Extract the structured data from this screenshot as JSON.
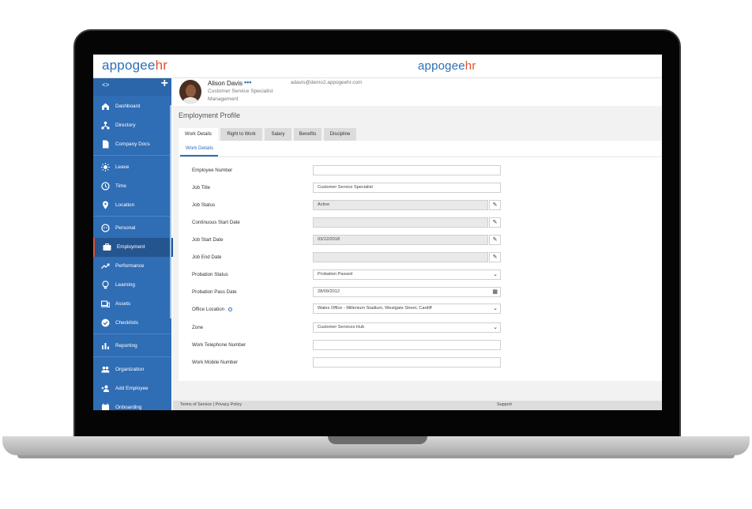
{
  "app": {
    "brand_left": {
      "part1": "appogee",
      "part2": "hr"
    },
    "brand_center": {
      "part1": "appogee",
      "part2": "hr"
    },
    "colors": {
      "brand_blue": "#2d6fb6",
      "brand_orange": "#e0532f",
      "sidebar": "#2f6db5"
    }
  },
  "sidebar": {
    "toggle_glyph": "<>",
    "add_glyph": "+",
    "items": [
      {
        "label": "Dashboard",
        "icon": "home-icon"
      },
      {
        "label": "Directory",
        "icon": "org-tree-icon"
      },
      {
        "label": "Company Docs",
        "icon": "document-icon"
      },
      {
        "label": "Leave",
        "icon": "sun-icon"
      },
      {
        "label": "Time",
        "icon": "clock-icon"
      },
      {
        "label": "Location",
        "icon": "map-pin-icon"
      },
      {
        "label": "Personal",
        "icon": "face-icon"
      },
      {
        "label": "Employment",
        "icon": "briefcase-icon",
        "active": true
      },
      {
        "label": "Performance",
        "icon": "trend-icon"
      },
      {
        "label": "Learning",
        "icon": "lightbulb-icon"
      },
      {
        "label": "Assets",
        "icon": "devices-icon"
      },
      {
        "label": "Checklists",
        "icon": "check-circle-icon"
      },
      {
        "label": "Reporting",
        "icon": "bar-chart-icon"
      },
      {
        "label": "Organization",
        "icon": "people-icon"
      },
      {
        "label": "Add Employee",
        "icon": "add-person-icon"
      },
      {
        "label": "Onboarding",
        "icon": "calendar-icon"
      }
    ]
  },
  "profile": {
    "name": "Alison Davis",
    "more": "•••",
    "role": "Customer Service Specialist",
    "department": "Management",
    "email": "adavis@demo2.appogeehr.com"
  },
  "page": {
    "title": "Employment Profile",
    "tabs": [
      "Work Details",
      "Right to Work",
      "Salary",
      "Benefits",
      "Discipline"
    ],
    "subtab": "Work Details"
  },
  "form": {
    "employee_number": {
      "label": "Employee Number",
      "value": ""
    },
    "job_title": {
      "label": "Job Title",
      "value": "Customer Service Specialist"
    },
    "job_status": {
      "label": "Job Status",
      "value": "Active"
    },
    "continuous_start_date": {
      "label": "Continuous Start Date",
      "value": ""
    },
    "job_start_date": {
      "label": "Job Start Date",
      "value": "03/12/2018"
    },
    "job_end_date": {
      "label": "Job End Date",
      "value": ""
    },
    "probation_status": {
      "label": "Probation Status",
      "value": "Probation Passed"
    },
    "probation_pass_date": {
      "label": "Probation Pass Date",
      "value": "28/09/2012"
    },
    "office_location": {
      "label": "Office Location",
      "value": "Wales Office - Millenium Stadium, Westgate Street, Cardiff"
    },
    "zone": {
      "label": "Zone",
      "value": "Customer Services Hub"
    },
    "work_telephone": {
      "label": "Work Telephone Number",
      "value": ""
    },
    "work_mobile": {
      "label": "Work Mobile Number",
      "value": ""
    }
  },
  "footer": {
    "left": "Terms of Service | Privacy Policy",
    "right": "Support"
  }
}
